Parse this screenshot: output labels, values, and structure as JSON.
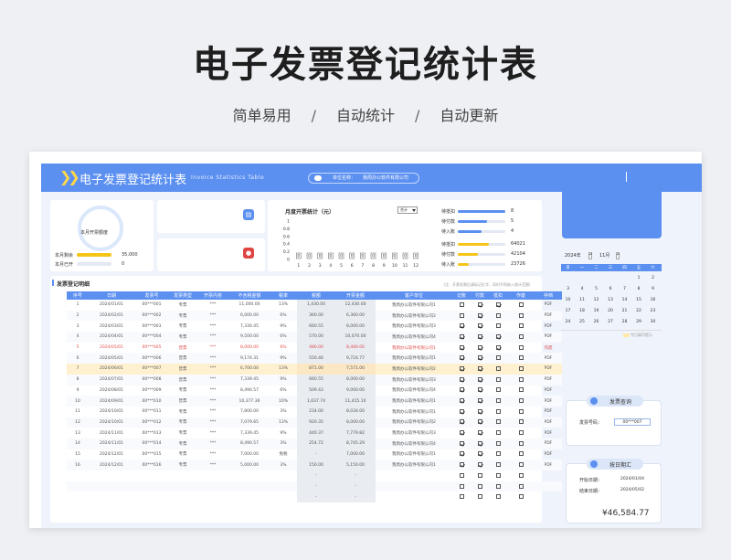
{
  "hero": {
    "title": "电子发票登记统计表",
    "sub1": "简单易用",
    "sep": "/",
    "sub2": "自动统计",
    "sub3": "自动更新"
  },
  "topbar": {
    "title": "电子发票登记统计表",
    "subtitle_en": "Invoice Statistics Table",
    "unit_label": "单位名称：",
    "unit_value": "我周办公软件有限公司"
  },
  "quota": {
    "center_label": "本月开票额度",
    "remaining_label": "本月剩余",
    "remaining_value": "35,000",
    "remaining_fraction": 1.0,
    "issued_label": "本月已开",
    "issued_value": "0",
    "issued_fraction": 0.0
  },
  "colors": {
    "accent": "#5b8ff0",
    "yellow": "#f5c518",
    "red_row": "#e05050",
    "highlight_row": "#fff1d0"
  },
  "icons": {
    "card1": "invoice-icon",
    "card2": "stamp-icon"
  },
  "chart": {
    "title": "月度开票统计（元）",
    "select_value": "合计",
    "chart_data": {
      "type": "bar",
      "categories": [
        "1",
        "2",
        "3",
        "4",
        "5",
        "6",
        "7",
        "8",
        "9",
        "10",
        "11",
        "12"
      ],
      "values": [
        0,
        0,
        0,
        0,
        0,
        0,
        0,
        0,
        0,
        0,
        0,
        0
      ],
      "data_labels": [
        "0",
        "0",
        "0",
        "0",
        "0",
        "0",
        "0",
        "0",
        "0",
        "0",
        "0",
        "0"
      ],
      "yticks": [
        "1",
        "0.8",
        "0.6",
        "0.4",
        "0.2",
        "0"
      ],
      "ylim": [
        0,
        1
      ],
      "xlabel": "",
      "ylabel": ""
    }
  },
  "stats": [
    {
      "label": "待抵扣",
      "value": "8",
      "fraction": 1.0,
      "color": "#5b8ff0"
    },
    {
      "label": "待付款",
      "value": "5",
      "fraction": 0.62,
      "color": "#5b8ff0"
    },
    {
      "label": "待入账",
      "value": "4",
      "fraction": 0.5,
      "color": "#5b8ff0"
    },
    {
      "label": "待抵扣",
      "value": "64021",
      "fraction": 0.65,
      "color": "#f5c518"
    },
    {
      "label": "待付款",
      "value": "42104",
      "fraction": 0.43,
      "color": "#f5c518"
    },
    {
      "label": "待入账",
      "value": "23726",
      "fraction": 0.24,
      "color": "#f5c518"
    }
  ],
  "panel": {
    "title": "发票登记明细",
    "note": "（注：开票发票后请标记红字，同时不再纳入统计范围）"
  },
  "table": {
    "headers": [
      "序号",
      "日期",
      "发票号",
      "发票类型",
      "开票内容",
      "不含税金额",
      "税率",
      "税额",
      "开票金额",
      "客户单位",
      "记账",
      "付款",
      "抵扣",
      "作废",
      "存档"
    ],
    "rows": [
      {
        "cells": [
          "1",
          "2024/01/01",
          "00***001",
          "专票",
          "***",
          "11,000.00",
          "13%",
          "1,430.00",
          "12,430.00",
          "我周办公软件有限公司1"
        ],
        "checks": [
          0,
          1,
          1,
          0
        ],
        "doc": "PDF",
        "style": ""
      },
      {
        "cells": [
          "2",
          "2024/02/01",
          "00***002",
          "专票",
          "***",
          "6,000.00",
          "6%",
          "360.00",
          "6,360.00",
          "我周办公软件有限公司2"
        ],
        "checks": [
          0,
          1,
          0,
          0
        ],
        "doc": "PDF",
        "style": ""
      },
      {
        "cells": [
          "3",
          "2024/03/01",
          "00***003",
          "专票",
          "***",
          "7,330.45",
          "9%",
          "660.55",
          "8,000.00",
          "我周办公软件有限公司3"
        ],
        "checks": [
          1,
          1,
          0,
          0
        ],
        "doc": "PDF",
        "style": ""
      },
      {
        "cells": [
          "4",
          "2024/04/01",
          "00***004",
          "专票",
          "***",
          "9,500.00",
          "6%",
          "570.00",
          "10,070.00",
          "我周办公软件有限公司4"
        ],
        "checks": [
          1,
          1,
          1,
          0
        ],
        "doc": "PDF",
        "style": ""
      },
      {
        "cells": [
          "5",
          "2024/05/01",
          "00***005",
          "普票",
          "***",
          "8,000.00",
          "6%",
          "480.00",
          "8,480.00",
          "我周办公软件有限公司1"
        ],
        "checks": [
          1,
          1,
          1,
          0
        ],
        "doc": "作废",
        "style": "red"
      },
      {
        "cells": [
          "6",
          "2024/05/01",
          "00***006",
          "普票",
          "***",
          "9,174.31",
          "9%",
          "550.46",
          "9,724.77",
          "我周办公软件有限公司1"
        ],
        "checks": [
          1,
          1,
          0,
          0
        ],
        "doc": "PDF",
        "style": ""
      },
      {
        "cells": [
          "7",
          "2024/06/01",
          "00***007",
          "普票",
          "***",
          "6,700.00",
          "13%",
          "871.00",
          "7,571.00",
          "我周办公软件有限公司2"
        ],
        "checks": [
          1,
          1,
          0,
          0
        ],
        "doc": "PDF",
        "style": "hl"
      },
      {
        "cells": [
          "8",
          "2024/07/01",
          "00***008",
          "普票",
          "***",
          "7,339.45",
          "9%",
          "660.55",
          "8,000.00",
          "我周办公软件有限公司3"
        ],
        "checks": [
          1,
          1,
          0,
          0
        ],
        "doc": "PDF",
        "style": ""
      },
      {
        "cells": [
          "9",
          "2024/08/01",
          "00***009",
          "专票",
          "***",
          "8,490.57",
          "6%",
          "509.43",
          "9,000.00",
          "我周办公软件有限公司4"
        ],
        "checks": [
          1,
          1,
          0,
          0
        ],
        "doc": "PDF",
        "style": ""
      },
      {
        "cells": [
          "10",
          "2024/09/01",
          "00***010",
          "普票",
          "***",
          "10,377.36",
          "10%",
          "1,037.74",
          "11,415.10",
          "我周办公软件有限公司1"
        ],
        "checks": [
          1,
          1,
          0,
          0
        ],
        "doc": "PDF",
        "style": ""
      },
      {
        "cells": [
          "11",
          "2024/10/01",
          "00***011",
          "专票",
          "***",
          "7,800.00",
          "3%",
          "234.00",
          "8,034.00",
          "我周办公软件有限公司1"
        ],
        "checks": [
          1,
          1,
          0,
          0
        ],
        "doc": "PDF",
        "style": ""
      },
      {
        "cells": [
          "12",
          "2024/10/01",
          "00***012",
          "专票",
          "***",
          "7,079.65",
          "13%",
          "920.35",
          "8,000.00",
          "我周办公软件有限公司2"
        ],
        "checks": [
          1,
          1,
          0,
          0
        ],
        "doc": "PDF",
        "style": ""
      },
      {
        "cells": [
          "13",
          "2024/11/01",
          "00***013",
          "专票",
          "***",
          "7,339.45",
          "9%",
          "440.37",
          "7,779.82",
          "我周办公软件有限公司3"
        ],
        "checks": [
          1,
          1,
          0,
          0
        ],
        "doc": "PDF",
        "style": ""
      },
      {
        "cells": [
          "14",
          "2024/11/01",
          "00***014",
          "专票",
          "***",
          "8,490.57",
          "3%",
          "254.72",
          "8,745.29",
          "我周办公软件有限公司4"
        ],
        "checks": [
          1,
          1,
          0,
          0
        ],
        "doc": "PDF",
        "style": ""
      },
      {
        "cells": [
          "15",
          "2024/12/01",
          "00***015",
          "专票",
          "***",
          "7,000.00",
          "免税",
          "-",
          "7,000.00",
          "我周办公软件有限公司1"
        ],
        "checks": [
          1,
          1,
          0,
          0
        ],
        "doc": "PDF",
        "style": ""
      },
      {
        "cells": [
          "16",
          "2024/12/01",
          "00***016",
          "专票",
          "***",
          "5,000.00",
          "3%",
          "150.00",
          "5,150.00",
          "我周办公软件有限公司1"
        ],
        "checks": [
          1,
          1,
          0,
          0
        ],
        "doc": "PDF",
        "style": ""
      },
      {
        "cells": [
          "",
          "",
          "",
          "",
          "",
          "",
          "",
          "-",
          "-",
          ""
        ],
        "checks": [
          0,
          0,
          0,
          0
        ],
        "doc": "",
        "style": ""
      },
      {
        "cells": [
          "",
          "",
          "",
          "",
          "",
          "",
          "",
          "-",
          "-",
          ""
        ],
        "checks": [
          0,
          0,
          0,
          0
        ],
        "doc": "",
        "style": ""
      },
      {
        "cells": [
          "",
          "",
          "",
          "",
          "",
          "",
          "",
          "-",
          "-",
          ""
        ],
        "checks": [
          0,
          0,
          0,
          0
        ],
        "doc": "",
        "style": ""
      }
    ]
  },
  "calendar": {
    "year": "2024年",
    "month": "11月",
    "weekdays": [
      "日",
      "一",
      "二",
      "三",
      "四",
      "五",
      "六"
    ],
    "weeks": [
      [
        "",
        "",
        "",
        "",
        "",
        "1",
        "2"
      ],
      [
        "3",
        "4",
        "5",
        "6",
        "7",
        "8",
        "9"
      ],
      [
        "10",
        "11",
        "12",
        "13",
        "14",
        "15",
        "16"
      ],
      [
        "17",
        "18",
        "19",
        "20",
        "21",
        "22",
        "23"
      ],
      [
        "24",
        "25",
        "26",
        "27",
        "28",
        "29",
        "30"
      ]
    ],
    "footer_note": "今日填写提示"
  },
  "query": {
    "title": "发票查询",
    "label": "发票号码：",
    "value": "00***007"
  },
  "date_query": {
    "title": "按日期汇",
    "start_label": "开始日期：",
    "start_value": "2024/01/04",
    "end_label": "结束日期：",
    "end_value": "2024/05/02",
    "total": "¥46,584.77"
  }
}
